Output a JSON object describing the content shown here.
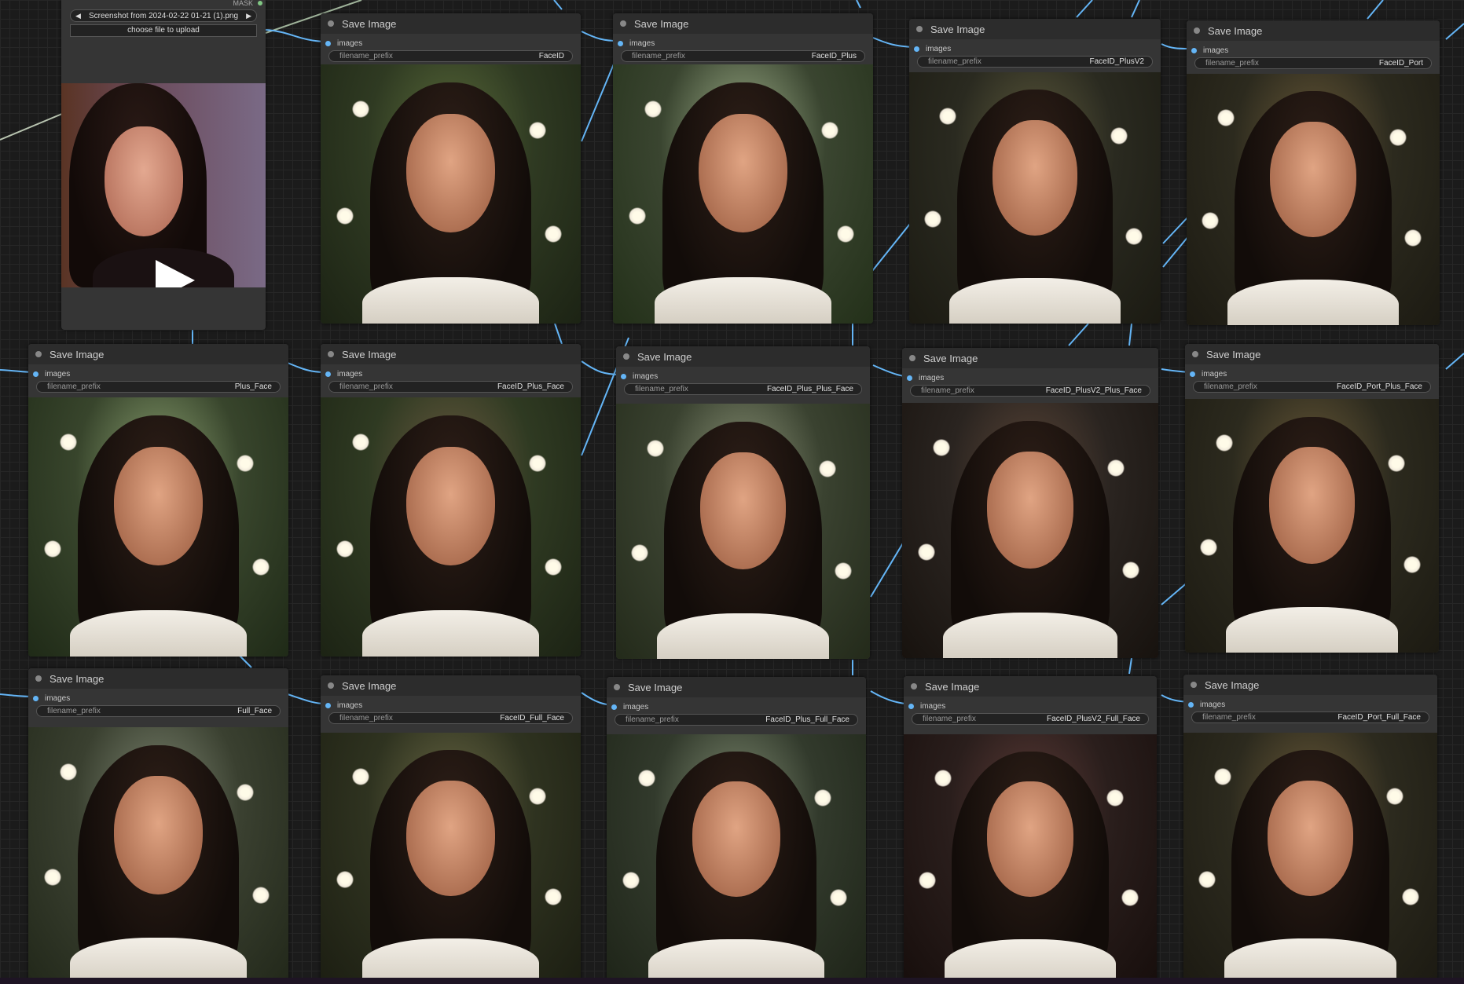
{
  "load_image": {
    "mask_label": "MASK",
    "filename": "Screenshot from 2024-02-22 01-21 (1).png",
    "upload_label": "choose file to upload",
    "prev_arrow": "◀",
    "next_arrow": "▶"
  },
  "node_title": "Save Image",
  "slot_label": "images",
  "widget_name": "filename_prefix",
  "save_nodes": [
    {
      "title": "Save Image",
      "input": "images",
      "widget": "filename_prefix",
      "value": "FaceID"
    },
    {
      "title": "Save Image",
      "input": "images",
      "widget": "filename_prefix",
      "value": "FaceID_Plus"
    },
    {
      "title": "Save Image",
      "input": "images",
      "widget": "filename_prefix",
      "value": "FaceID_PlusV2"
    },
    {
      "title": "Save Image",
      "input": "images",
      "widget": "filename_prefix",
      "value": "FaceID_Port"
    },
    {
      "title": "Save Image",
      "input": "images",
      "widget": "filename_prefix",
      "value": "Plus_Face"
    },
    {
      "title": "Save Image",
      "input": "images",
      "widget": "filename_prefix",
      "value": "FaceID_Plus_Face"
    },
    {
      "title": "Save Image",
      "input": "images",
      "widget": "filename_prefix",
      "value": "FaceID_Plus_Plus_Face"
    },
    {
      "title": "Save Image",
      "input": "images",
      "widget": "filename_prefix",
      "value": "FaceID_PlusV2_Plus_Face"
    },
    {
      "title": "Save Image",
      "input": "images",
      "widget": "filename_prefix",
      "value": "FaceID_Port_Plus_Face"
    },
    {
      "title": "Save Image",
      "input": "images",
      "widget": "filename_prefix",
      "value": "Full_Face"
    },
    {
      "title": "Save Image",
      "input": "images",
      "widget": "filename_prefix",
      "value": "FaceID_Full_Face"
    },
    {
      "title": "Save Image",
      "input": "images",
      "widget": "filename_prefix",
      "value": "FaceID_Plus_Full_Face"
    },
    {
      "title": "Save Image",
      "input": "images",
      "widget": "filename_prefix",
      "value": "FaceID_PlusV2_Full_Face"
    },
    {
      "title": "Save Image",
      "input": "images",
      "widget": "filename_prefix",
      "value": "FaceID_Port_Full_Face"
    }
  ],
  "colors": {
    "canvas_bg": "#1b1b1b",
    "node_bg": "#353535",
    "node_title_bg": "#2c2c2c",
    "link_color": "#64b5f6",
    "input_dot": "#64b5f6",
    "mask_dot": "#81c784"
  }
}
